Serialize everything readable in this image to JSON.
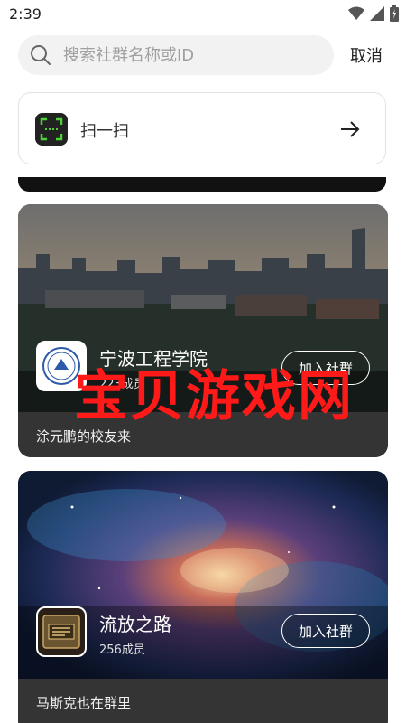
{
  "status_bar": {
    "time": "2:39"
  },
  "search": {
    "placeholder": "搜索社群名称或ID",
    "cancel_label": "取消"
  },
  "scan": {
    "label": "扫一扫"
  },
  "groups": [
    {
      "name": "宁波工程学院",
      "members": "223成员",
      "join_label": "加入社群",
      "description": "涂元鹏的校友来"
    },
    {
      "name": "流放之路",
      "members": "256成员",
      "join_label": "加入社群",
      "description": "马斯克也在群里"
    }
  ],
  "watermark": "宝贝游戏网",
  "colors": {
    "watermark": "#ff1a1a",
    "card_footer": "#343434",
    "scan_accent": "#4cd137"
  }
}
